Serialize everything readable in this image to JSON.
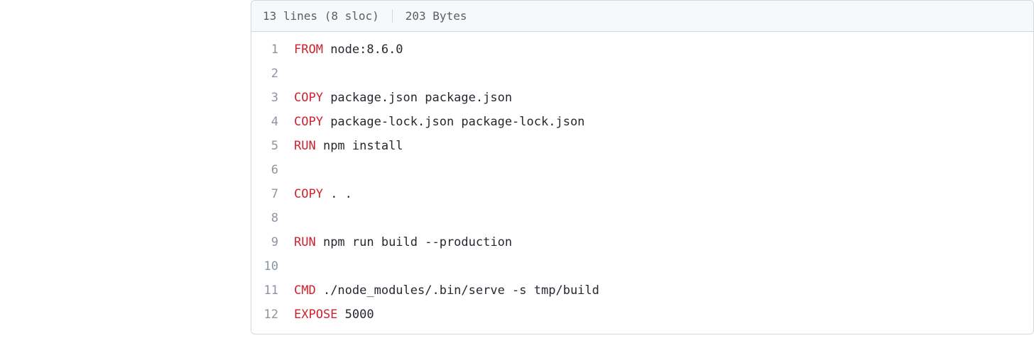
{
  "file_info": {
    "lines_text": "13 lines (8 sloc)",
    "bytes_text": "203 Bytes"
  },
  "code": {
    "lines": [
      {
        "n": "1",
        "kw": "FROM",
        "rest": " node:8.6.0"
      },
      {
        "n": "2",
        "kw": "",
        "rest": ""
      },
      {
        "n": "3",
        "kw": "COPY",
        "rest": " package.json package.json"
      },
      {
        "n": "4",
        "kw": "COPY",
        "rest": " package-lock.json package-lock.json"
      },
      {
        "n": "5",
        "kw": "RUN",
        "rest": " npm install"
      },
      {
        "n": "6",
        "kw": "",
        "rest": ""
      },
      {
        "n": "7",
        "kw": "COPY",
        "rest": " . ."
      },
      {
        "n": "8",
        "kw": "",
        "rest": ""
      },
      {
        "n": "9",
        "kw": "RUN",
        "rest": " npm run build --production"
      },
      {
        "n": "10",
        "kw": "",
        "rest": ""
      },
      {
        "n": "11",
        "kw": "CMD",
        "rest": " ./node_modules/.bin/serve -s tmp/build"
      },
      {
        "n": "12",
        "kw": "EXPOSE",
        "rest": " 5000"
      }
    ]
  }
}
